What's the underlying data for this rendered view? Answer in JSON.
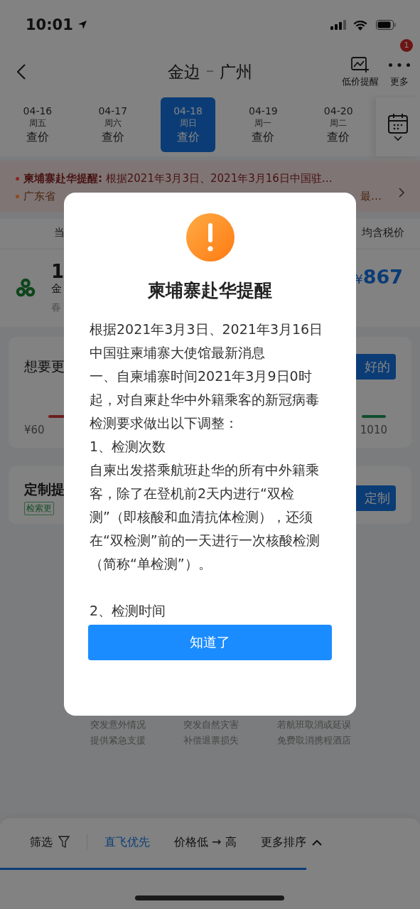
{
  "status_bar": {
    "time": "10:01"
  },
  "nav": {
    "from": "金边",
    "separator": "–",
    "to": "广州",
    "actions": [
      {
        "kind": "alert",
        "label": "低价提醒"
      },
      {
        "kind": "more",
        "label": "更多",
        "badge": "1"
      }
    ]
  },
  "dates": [
    {
      "date": "04-16",
      "weekday": "周五",
      "price": "查价",
      "selected": false
    },
    {
      "date": "04-17",
      "weekday": "周六",
      "price": "查价",
      "selected": false
    },
    {
      "date": "04-18",
      "weekday": "周日",
      "price": "查价",
      "selected": true
    },
    {
      "date": "04-19",
      "weekday": "周一",
      "price": "查价",
      "selected": false
    },
    {
      "date": "04-20",
      "weekday": "周二",
      "price": "查价",
      "selected": false
    }
  ],
  "notices": [
    {
      "color": "#8c2424",
      "text": "**柬埔寨赴华提醒:** 根据2021年3月3日、2021年3月16日中国驻…"
    },
    {
      "color": "#8e4a1c",
      "text": "广东省",
      "tail": "最…"
    }
  ],
  "list_header": {
    "left": "当",
    "right": "均含税价"
  },
  "flight": {
    "time": "1",
    "from": "金",
    "note": "春",
    "currency": "¥",
    "price": "867"
  },
  "preference_card": {
    "title": "想要更",
    "button": "好的",
    "low": "¥60",
    "high": "1010"
  },
  "custom_card": {
    "title": "定制提",
    "tag": "检索更",
    "button": "定制"
  },
  "benefits": [
    {
      "line1": "突发意外情况",
      "line2": "提供紧急支援"
    },
    {
      "line1": "突发自然灾害",
      "line2": "补偿退票损失"
    },
    {
      "line1": "若航班取消或延误",
      "line2": "免费取消携程酒店"
    }
  ],
  "bottom_bar": {
    "filter": "筛选",
    "sorts": [
      {
        "kind": "plain",
        "label": "直飞优先",
        "selected": true
      },
      {
        "kind": "plain",
        "label": "价格低 → 高",
        "selected": false
      },
      {
        "kind": "dropdown",
        "label": "更多排序",
        "selected": false
      }
    ],
    "progress": {
      "level": 0.73
    }
  },
  "dialog": {
    "title": "柬埔寨赴华提醒",
    "paragraphs": [
      {
        "text": "根据2021年3月3日、2021年3月16日中国驻柬埔寨大使馆最新消息"
      },
      {
        "text": "一、自柬埔寨时间2021年3月9日0时起，对自柬赴华中外籍乘客的新冠病毒检测要求做出以下调整："
      },
      {
        "text": "1、检测次数"
      },
      {
        "text": "自柬出发搭乘航班赴华的所有中外籍乘客，除了在登机前2天内进行“双检测”（即核酸和血清抗体检测），还须在“双检测”前的一天进行一次核酸检测（简称“单检测”）。"
      },
      {
        "text": "2、检测时间"
      }
    ],
    "button": "知道了"
  }
}
